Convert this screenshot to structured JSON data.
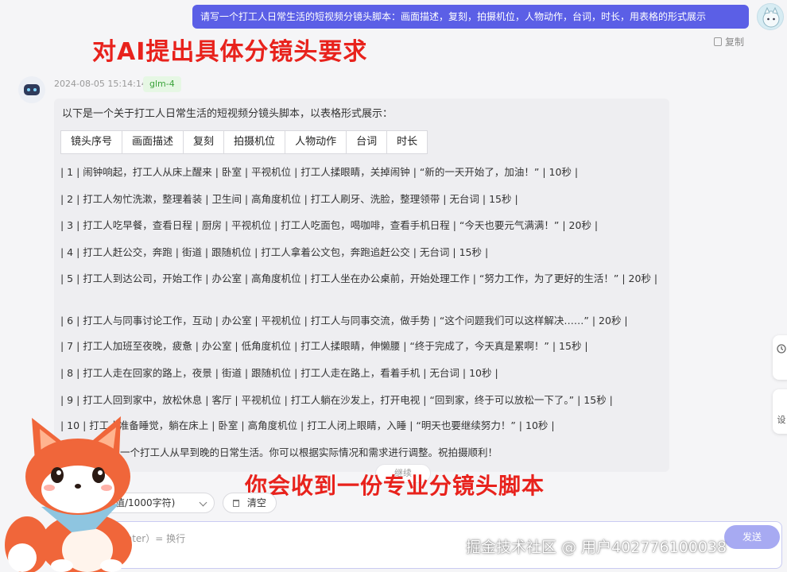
{
  "user_message": "请写一个打工人日常生活的短视频分镜头脚本：画面描述，复刻，拍摄机位，人物动作，台词，时长，用表格的形式展示",
  "copy_label": "复制",
  "annotations": {
    "top": "对AI提出具体分镜头要求",
    "bottom": "你会收到一份专业分镜头脚本"
  },
  "reply": {
    "timestamp": "2024-08-05 15:14:14",
    "model": "glm-4",
    "intro": "以下是一个关于打工人日常生活的短视频分镜头脚本，以表格形式展示：",
    "headers": [
      "镜头序号",
      "画面描述",
      "复刻",
      "拍摄机位",
      "人物动作",
      "台词",
      "时长"
    ],
    "rows": [
      "| 1 | 闹钟响起，打工人从床上醒来 | 卧室 | 平视机位 | 打工人揉眼睛，关掉闹钟 | “新的一天开始了，加油！” | 10秒 |",
      "| 2 | 打工人匆忙洗漱，整理着装 | 卫生间 | 高角度机位 | 打工人刷牙、洗脸，整理领带 | 无台词 | 15秒 |",
      "| 3 | 打工人吃早餐，查看日程 | 厨房 | 平视机位 | 打工人吃面包，喝咖啡，查看手机日程 | “今天也要元气满满！” | 20秒 |",
      "| 4 | 打工人赶公交，奔跑 | 街道 | 跟随机位 | 打工人拿着公文包，奔跑追赶公交 | 无台词 | 15秒 |",
      "| 5 | 打工人到达公司，开始工作 | 办公室 | 高角度机位 | 打工人坐在办公桌前，开始处理工作 | “努力工作，为了更好的生活！” | 20秒 |",
      "| 6 | 打工人与同事讨论工作，互动 | 办公室 | 平视机位 | 打工人与同事交流，做手势 | “这个问题我们可以这样解决……” | 20秒 |",
      "| 7 | 打工人加班至夜晚，疲惫 | 办公室 | 低角度机位 | 打工人揉眼睛，伸懒腰 | “终于完成了，今天真是累啊！” | 15秒 |",
      "| 8 | 打工人走在回家的路上，夜景 | 街道 | 跟随机位 | 打工人走在路上，看着手机 | 无台词 | 10秒 |",
      "| 9 | 打工人回到家中，放松休息 | 客厅 | 平视机位 | 打工人躺在沙发上，打开电视 | “回到家，终于可以放松一下了。” | 15秒 |",
      "| 10 | 打工人准备睡觉，躺在床上 | 卧室 | 高角度机位 | 打工人闭上眼睛，入睡 | “明天也要继续努力！” | 10秒 |"
    ],
    "summary": "本脚本展示了一个打工人从早到晚的日常生活。你可以根据实际情况和需求进行调整。祝拍摄顺利！"
  },
  "continue_label": "继续",
  "side_tabs": [
    "设"
  ],
  "toolbar": {
    "limit": "值/1000字符)",
    "clear": "清空"
  },
  "input": {
    "hint": "Enter）= 换行",
    "send": "发送"
  },
  "watermark": "掘金技术社区 @ 用户402776100038"
}
